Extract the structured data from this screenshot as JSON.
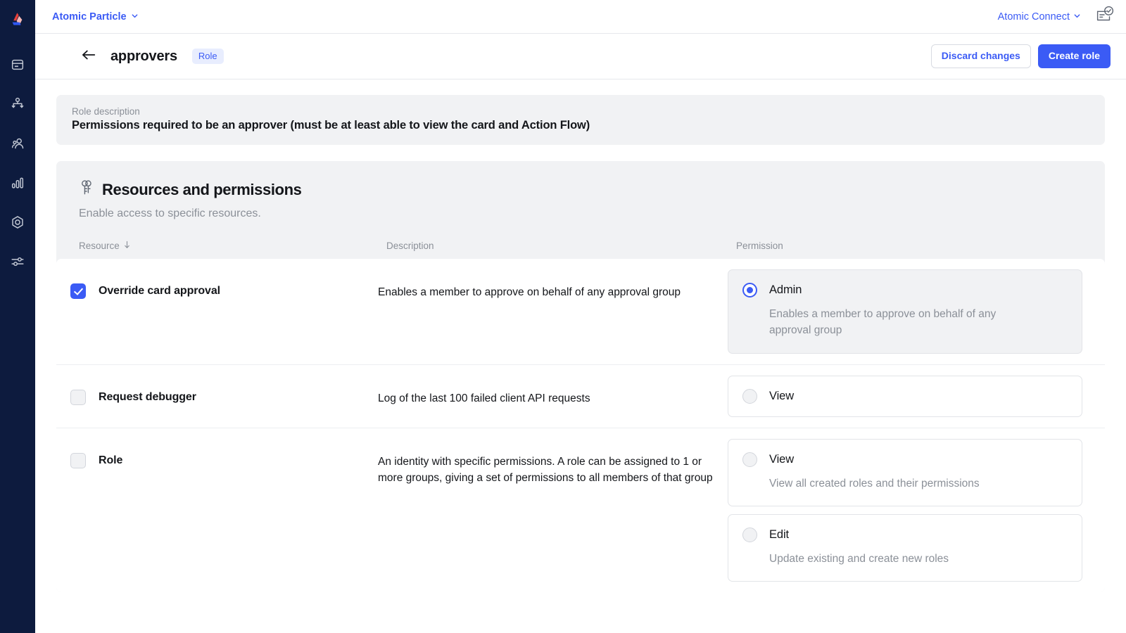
{
  "brand": {
    "logo_name": "atomic-logo",
    "sidebar_bg": "#0d1b3e",
    "accent": "#3b5bf5",
    "panel_bg": "#f1f2f4"
  },
  "sidebar": {
    "items": [
      {
        "icon": "card-icon",
        "name": "sidebar-item-cards"
      },
      {
        "icon": "action-flow-icon",
        "name": "sidebar-item-action-flow"
      },
      {
        "icon": "members-icon",
        "name": "sidebar-item-members"
      },
      {
        "icon": "reports-icon",
        "name": "sidebar-item-reports"
      },
      {
        "icon": "hexagon-icon",
        "name": "sidebar-item-settings"
      },
      {
        "icon": "sliders-icon",
        "name": "sidebar-item-controls"
      }
    ]
  },
  "topbar": {
    "org_name": "Atomic Particle",
    "org_chevron_icon": "chevron-down-icon",
    "connect_name": "Atomic Connect",
    "connect_chevron_icon": "chevron-down-icon",
    "status_icon": "card-approved-icon"
  },
  "header": {
    "back_icon": "arrow-left-icon",
    "title": "approvers",
    "badge": "Role",
    "discard_label": "Discard changes",
    "create_label": "Create role"
  },
  "role_description": {
    "label": "Role description",
    "value": "Permissions required to be an approver (must be at least able to view the card and Action Flow)"
  },
  "resources_panel": {
    "icon": "keys-icon",
    "title": "Resources and permissions",
    "subtitle": "Enable access to specific resources.",
    "columns": {
      "resource": "Resource",
      "resource_sort_icon": "arrow-down-icon",
      "description": "Description",
      "permission": "Permission"
    },
    "rows": [
      {
        "name": "Override card approval",
        "checked": true,
        "description": "Enables a member to approve on behalf of any approval group",
        "permissions": [
          {
            "label": "Admin",
            "description": "Enables a member to approve on behalf of any approval group",
            "selected": true
          }
        ]
      },
      {
        "name": "Request debugger",
        "checked": false,
        "description": "Log of the last 100 failed client API requests",
        "permissions": [
          {
            "label": "View",
            "description": "",
            "selected": false
          }
        ]
      },
      {
        "name": "Role",
        "checked": false,
        "description": "An identity with specific permissions. A role can be assigned to 1 or more groups, giving a set of permissions to all members of that group",
        "permissions": [
          {
            "label": "View",
            "description": "View all created roles and their permissions",
            "selected": false
          },
          {
            "label": "Edit",
            "description": "Update existing and create new roles",
            "selected": false
          }
        ]
      }
    ]
  }
}
